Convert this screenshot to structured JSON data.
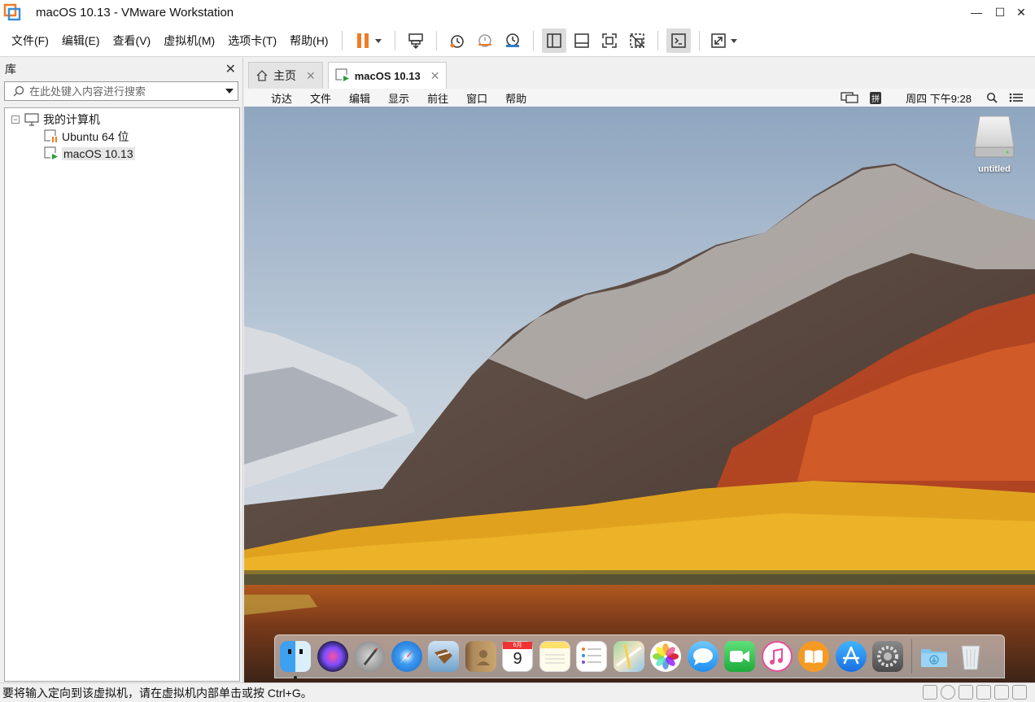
{
  "window": {
    "title": "macOS 10.13 - VMware Workstation",
    "controls": {
      "minimize": "—",
      "maximize": "☐",
      "close": "✕"
    }
  },
  "menu": {
    "items": [
      "文件(F)",
      "编辑(E)",
      "查看(V)",
      "虚拟机(M)",
      "选项卡(T)",
      "帮助(H)"
    ]
  },
  "toolbar": {
    "buttons": [
      "pause-icon",
      "send-ctrl-alt-del-icon",
      "snapshot-icon",
      "revert-snapshot-icon",
      "snapshot-manager-icon",
      "show-library-icon",
      "thumbnail-bar-icon",
      "full-screen-icon",
      "unity-icon",
      "console-view-icon",
      "stretch-guest-icon"
    ]
  },
  "library": {
    "header": "库",
    "close": "✕",
    "search_placeholder": "在此处键入内容进行搜索",
    "tree": {
      "root_toggle": "⊟",
      "root_label": "我的计算机",
      "items": [
        {
          "label": "Ubuntu 64 位",
          "state": "paused"
        },
        {
          "label": "macOS 10.13",
          "state": "running",
          "selected": true
        }
      ]
    }
  },
  "tabs": [
    {
      "label": "主页",
      "close": "✕",
      "active": false
    },
    {
      "label": "macOS 10.13",
      "close": "✕",
      "active": true
    }
  ],
  "guest": {
    "menubar": {
      "apple": "",
      "items": [
        "访达",
        "文件",
        "编辑",
        "显示",
        "前往",
        "窗口",
        "帮助"
      ],
      "clock": "周四 下午9:28",
      "input_method": "拼"
    },
    "desktop": {
      "disk_label": "untitled"
    },
    "dock": {
      "apps": [
        "finder-icon",
        "siri-icon",
        "launchpad-icon",
        "safari-icon",
        "mail-icon",
        "contacts-icon",
        "calendar-icon",
        "notes-icon",
        "reminders-icon",
        "maps-icon",
        "photos-icon",
        "messages-icon",
        "facetime-icon",
        "itunes-icon",
        "ibooks-icon",
        "app-store-icon",
        "system-preferences-icon"
      ],
      "calendar_day": "9",
      "calendar_month": "6月",
      "extras": [
        "downloads-folder-icon",
        "trash-icon"
      ]
    }
  },
  "statusbar": {
    "text": "要将输入定向到该虚拟机，请在虚拟机内部单击或按 Ctrl+G。"
  },
  "colors": {
    "accent_orange": "#f07c28",
    "titlebar_bg": "#ffffff",
    "chrome_bg": "#f0f0f0",
    "running_green": "#2a9d3c"
  }
}
